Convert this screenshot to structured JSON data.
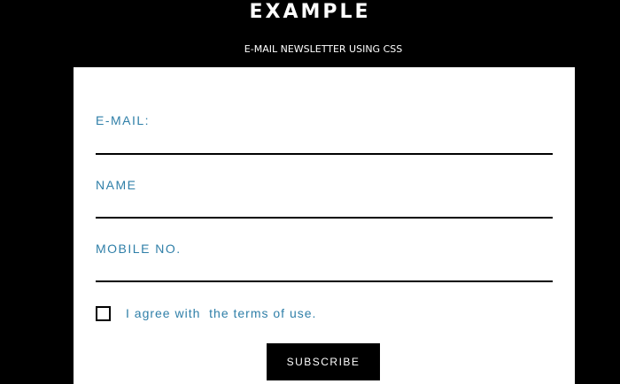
{
  "header": {
    "title": "EXAMPLE",
    "subtitle": "E-MAIL NEWSLETTER USING CSS"
  },
  "form": {
    "fields": [
      {
        "label": "E-MAIL:",
        "value": ""
      },
      {
        "label": "NAME",
        "value": ""
      },
      {
        "label": "MOBILE NO.",
        "value": ""
      }
    ],
    "terms": {
      "checked": false,
      "label": "I agree with  the terms of use."
    },
    "submit_label": "SUBSCRIBE"
  },
  "colors": {
    "background": "#000000",
    "card": "#ffffff",
    "label": "#2f7fa8",
    "button": "#000000",
    "button_text": "#ffffff"
  }
}
